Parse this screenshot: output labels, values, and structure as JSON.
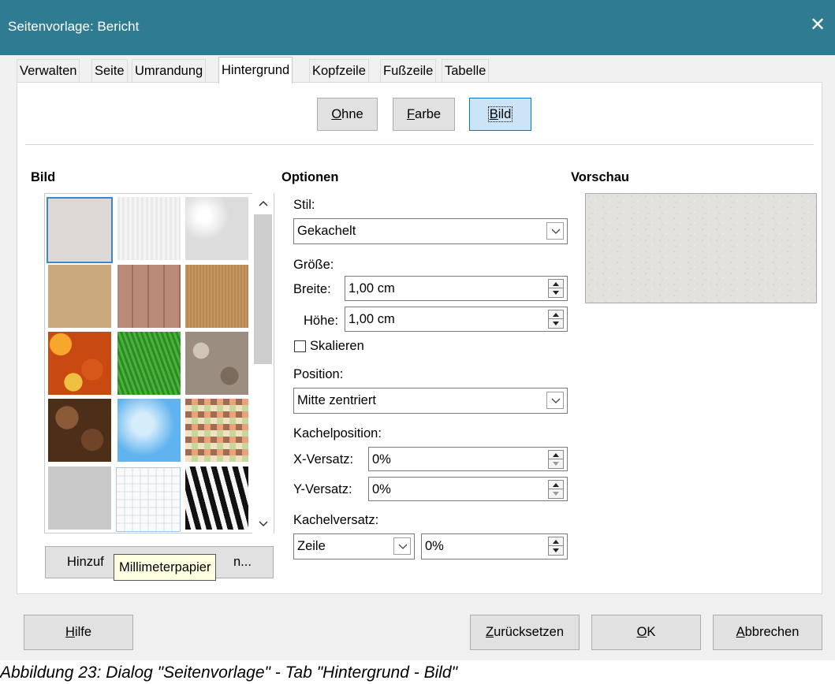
{
  "window": {
    "title": "Seitenvorlage: Bericht",
    "close_glyph": "✕"
  },
  "tabs": [
    {
      "label": "Verwalten"
    },
    {
      "label": "Seite"
    },
    {
      "label": "Umrandung"
    },
    {
      "label": "Hintergrund",
      "active": true
    },
    {
      "label": "Kopfzeile"
    },
    {
      "label": "Fußzeile"
    },
    {
      "label": "Tabelle"
    }
  ],
  "fill_type": {
    "none": {
      "mnemonic": "O",
      "rest": "hne"
    },
    "color": {
      "mnemonic": "F",
      "rest": "arbe"
    },
    "image": {
      "mnemonic": "B",
      "rest": "ild"
    },
    "selected": "image"
  },
  "gallery": {
    "heading": "Bild",
    "selected_index": 0,
    "hovered": "Millimeterpapier",
    "add_button_visible": "Hinzuf",
    "add_button_tail": "n..."
  },
  "options": {
    "heading": "Optionen",
    "style_label": "Stil:",
    "style_value": "Gekachelt",
    "size_label": "Größe:",
    "width_label": "Breite:",
    "width_value": "1,00 cm",
    "height_label": "Höhe:",
    "height_value": "1,00 cm",
    "scale_label": "Skalieren",
    "scale_checked": false,
    "position_label": "Position:",
    "position_value": "Mitte zentriert",
    "tile_position_label": "Kachelposition:",
    "x_offset_label": "X-Versatz:",
    "x_offset_value": "0%",
    "y_offset_label": "Y-Versatz:",
    "y_offset_value": "0%",
    "tile_offset_label": "Kachelversatz:",
    "tile_offset_mode": "Zeile",
    "tile_offset_value": "0%"
  },
  "preview": {
    "heading": "Vorschau"
  },
  "footer": {
    "help": {
      "mnemonic": "H",
      "rest": "ilfe"
    },
    "reset": {
      "mnemonic": "Z",
      "rest": "urücksetzen"
    },
    "ok": {
      "mnemonic": "O",
      "rest": "K"
    },
    "cancel": {
      "mnemonic": "A",
      "rest": "bbrechen"
    }
  },
  "caption": "Abbildung 23: Dialog \"Seitenvorlage\" - Tab \"Hintergrund - Bild\"",
  "colors": {
    "titlebar": "#2f7c92",
    "selected_border": "#0078d7",
    "selected_fill": "#cce4f7"
  }
}
